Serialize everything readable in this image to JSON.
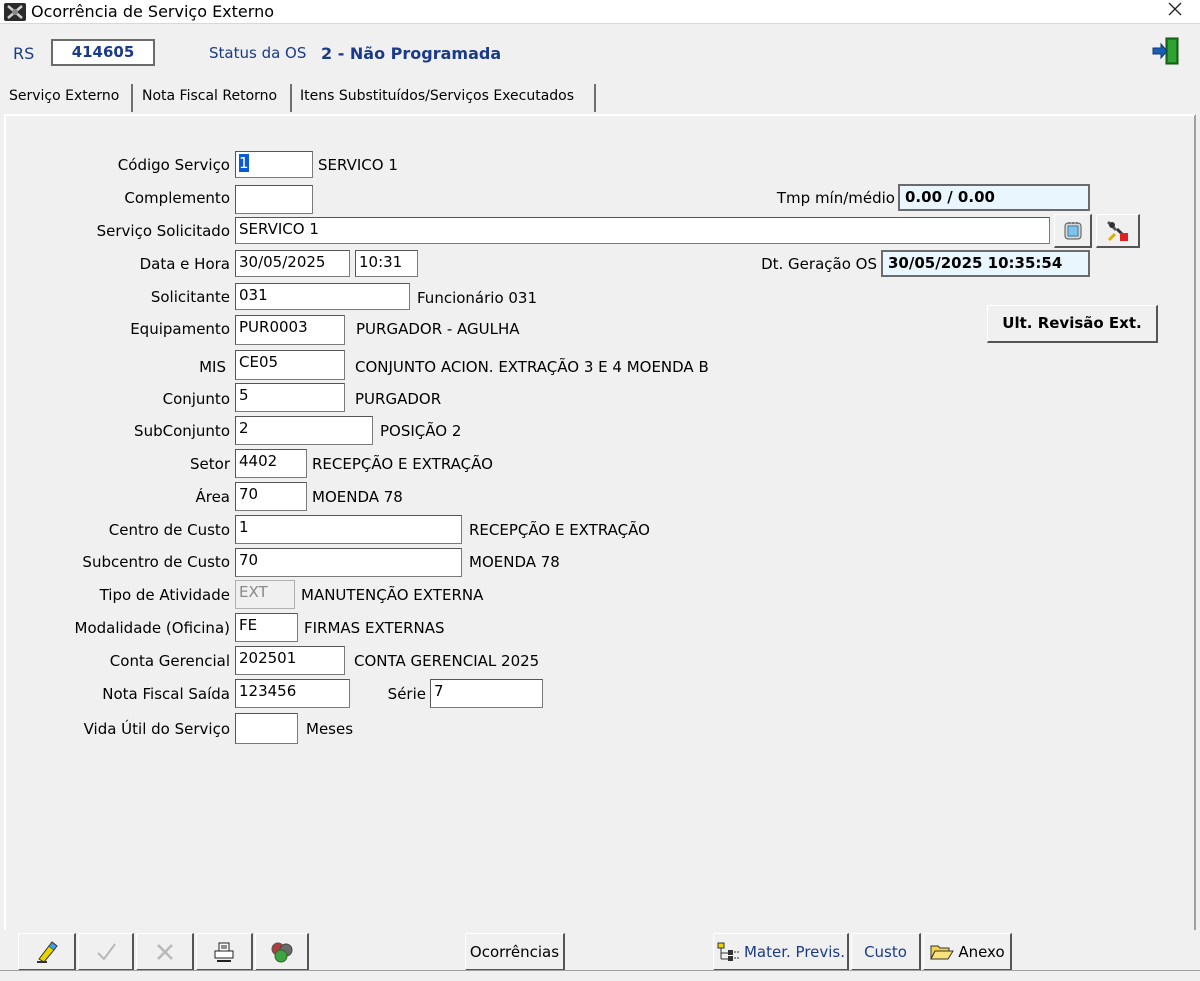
{
  "window": {
    "title": "Ocorrência de Serviço Externo",
    "close_glyph": "✕"
  },
  "header": {
    "rs_label": "RS",
    "rs_value": "414605",
    "status_label": "Status da OS",
    "status_value": "2 - Não Programada",
    "exit_icon": "exit-door-icon"
  },
  "tabs": [
    {
      "label": "Serviço Externo",
      "active": true
    },
    {
      "label": "Nota Fiscal Retorno",
      "active": false
    },
    {
      "label": "Itens Substituídos/Serviços Executados",
      "active": false
    }
  ],
  "form": {
    "codigo_servico": {
      "label": "Código Serviço",
      "value": "1",
      "desc": "SERVICO 1"
    },
    "complemento": {
      "label": "Complemento",
      "value": ""
    },
    "tmp": {
      "label": "Tmp mín/médio",
      "value": "0.00 / 0.00"
    },
    "servico_solicitado": {
      "label": "Serviço Solicitado",
      "value": "SERVICO 1"
    },
    "data_hora": {
      "label": "Data e Hora",
      "date": "30/05/2025",
      "time": "10:31"
    },
    "dt_geracao": {
      "label": "Dt. Geração OS",
      "value": "30/05/2025 10:35:54"
    },
    "solicitante": {
      "label": "Solicitante",
      "value": "031",
      "desc": "Funcionário 031"
    },
    "equipamento": {
      "label": "Equipamento",
      "value": "PUR0003",
      "desc": "PURGADOR - AGULHA"
    },
    "ult_revisao_button": "Ult. Revisão Ext.",
    "mis": {
      "label": "MIS",
      "value": "CE05",
      "desc": "CONJUNTO ACION. EXTRAÇÃO 3 E 4 MOENDA B"
    },
    "conjunto": {
      "label": "Conjunto",
      "value": "5",
      "desc": "PURGADOR"
    },
    "subconjunto": {
      "label": "SubConjunto",
      "value": "2",
      "desc": "POSIÇÃO 2"
    },
    "setor": {
      "label": "Setor",
      "value": "4402",
      "desc": "RECEPÇÃO E EXTRAÇÃO"
    },
    "area": {
      "label": "Área",
      "value": "70",
      "desc": "MOENDA 78"
    },
    "centro_custo": {
      "label": "Centro de Custo",
      "value": "1",
      "desc": "RECEPÇÃO E EXTRAÇÃO"
    },
    "subcentro_custo": {
      "label": "Subcentro de Custo",
      "value": "70",
      "desc": "MOENDA 78"
    },
    "tipo_atividade": {
      "label": "Tipo de Atividade",
      "value": "EXT",
      "desc": "MANUTENÇÃO EXTERNA"
    },
    "modalidade": {
      "label": "Modalidade (Oficina)",
      "value": "FE",
      "desc": "FIRMAS EXTERNAS"
    },
    "conta_gerencial": {
      "label": "Conta Gerencial",
      "value": "202501",
      "desc": "CONTA GERENCIAL 2025"
    },
    "nota_fiscal_saida": {
      "label": "Nota Fiscal Saída",
      "value": "123456"
    },
    "serie": {
      "label": "Série",
      "value": "7"
    },
    "vida_util": {
      "label": "Vida Útil do Serviço",
      "value": "",
      "unit": "Meses"
    }
  },
  "toolbar": {
    "ocorrencias": "Ocorrências",
    "mater_previs": "Mater. Previs.",
    "custo": "Custo",
    "anexo": "Anexo"
  }
}
